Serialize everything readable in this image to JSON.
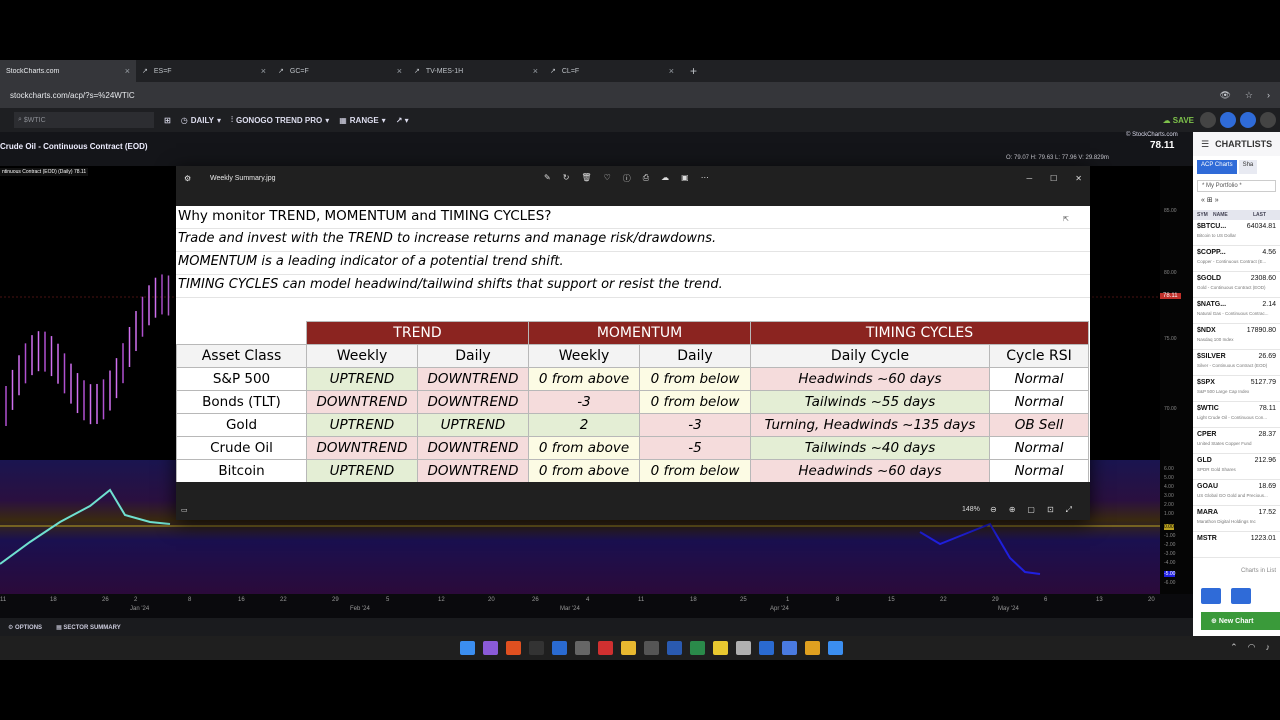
{
  "browser": {
    "tabs": [
      {
        "icon": "stockcharts-icon",
        "title": "StockCharts.com",
        "active": true
      },
      {
        "icon": "chart-icon",
        "title": "ES=F"
      },
      {
        "icon": "chart-icon",
        "title": "GC=F"
      },
      {
        "icon": "chart-icon",
        "title": "TV-MES-1H"
      },
      {
        "icon": "chart-icon",
        "title": "CL=F"
      }
    ],
    "new_tab": "+",
    "url": "stockcharts.com/acp/?s=%24WTIC"
  },
  "toolbar": {
    "symbol_placeholder": "$WTIC",
    "period": "DAILY",
    "indicator": "GONOGO TREND PRO",
    "range": "RANGE",
    "save": "SAVE"
  },
  "chart": {
    "title": "Crude Oil - Continuous Contract (EOD)",
    "sublabel": "ntinuous Contract (EOD) (Daily) 78.11",
    "last_price": "78.11",
    "logo": "© StockCharts.com",
    "ohlc": "O: 79.07   H: 79.63   L: 77.96   V: 29.829m",
    "price_marker": "78.11",
    "right_axis": [
      "85.00",
      "80.00",
      "75.00",
      "70.00",
      "6.00",
      "5.00",
      "4.00",
      "3.00",
      "2.00",
      "1.00",
      "0.00",
      "-1.00",
      "-2.00",
      "-3.00",
      "-4.00",
      "-5.00",
      "-6.00"
    ],
    "x_axis_dates": [
      "11",
      "18",
      "26",
      "2",
      "8",
      "16",
      "22",
      "29",
      "5",
      "12",
      "20",
      "26",
      "4",
      "11",
      "18",
      "25",
      "1",
      "8",
      "15",
      "22",
      "29",
      "6",
      "13",
      "20"
    ],
    "x_axis_months": [
      "Jan '24",
      "Feb '24",
      "Mar '24",
      "Apr '24",
      "May '24"
    ]
  },
  "statusbar": {
    "options": "OPTIONS",
    "sector": "SECTOR SUMMARY"
  },
  "sidebar": {
    "header": "CHARTLISTS",
    "tabs": [
      "ACP Charts",
      "Sha"
    ],
    "portfolio": "* My Portfolio *",
    "columns": [
      "SYM",
      "NAME",
      "LAST"
    ],
    "items": [
      {
        "sym": "$BTCU...",
        "desc": "Bitcoin to US Dollar",
        "last": "64034.81"
      },
      {
        "sym": "$COPP...",
        "desc": "Copper - Continuous Contract (E...",
        "last": "4.56"
      },
      {
        "sym": "$GOLD",
        "desc": "Gold - Continuous Contract (EOD)",
        "last": "2308.60"
      },
      {
        "sym": "$NATG...",
        "desc": "Natural Gas - Continuous Contrac...",
        "last": "2.14"
      },
      {
        "sym": "$NDX",
        "desc": "Nasdaq 100 Index",
        "last": "17890.80"
      },
      {
        "sym": "$SILVER",
        "desc": "Silver - Continuous Contract (EOD)",
        "last": "26.69"
      },
      {
        "sym": "$SPX",
        "desc": "S&P 500 Large Cap Index",
        "last": "5127.79"
      },
      {
        "sym": "$WTIC",
        "desc": "Light Crude Oil - Continuous Con...",
        "last": "78.11"
      },
      {
        "sym": "CPER",
        "desc": "United States Copper Fund",
        "last": "28.37"
      },
      {
        "sym": "GLD",
        "desc": "SPDR Gold Shares",
        "last": "212.96"
      },
      {
        "sym": "GOAU",
        "desc": "US Global GO Gold and Precious...",
        "last": "18.69"
      },
      {
        "sym": "MARA",
        "desc": "Marathon Digital Holdings Inc",
        "last": "17.52"
      },
      {
        "sym": "MSTR",
        "desc": "",
        "last": "1223.01"
      }
    ],
    "footer_label": "Charts in List",
    "new_chart": "New Chart"
  },
  "viewer": {
    "title": "Weekly Summary.jpg",
    "zoom": "148%",
    "image": {
      "lines": [
        "Why monitor TREND, MOMENTUM and TIMING CYCLES?",
        "Trade and invest with the TREND to increase returns and manage risk/drawdowns.",
        "MOMENTUM is a leading indicator of a potential trend shift.",
        "TIMING CYCLES can model headwind/tailwind shifts that support or resist the trend."
      ],
      "groups": [
        "TREND",
        "MOMENTUM",
        "TIMING CYCLES"
      ],
      "headers": [
        "Asset Class",
        "Weekly",
        "Daily",
        "Weekly",
        "Daily",
        "Daily Cycle",
        "Cycle RSI"
      ],
      "rows": [
        {
          "cells": [
            "S&P 500",
            "UPTREND",
            "DOWNTREND",
            "0 from above",
            "0 from below",
            "Headwinds ~60 days",
            "Normal"
          ],
          "colors": [
            "w",
            "g",
            "r",
            "y",
            "y",
            "r",
            "w"
          ]
        },
        {
          "cells": [
            "Bonds (TLT)",
            "DOWNTREND",
            "DOWNTREND",
            "-3",
            "0 from below",
            "Tailwinds ~55 days",
            "Normal"
          ],
          "colors": [
            "w",
            "r",
            "r",
            "r",
            "y",
            "g",
            "w"
          ]
        },
        {
          "cells": [
            "Gold",
            "UPTREND",
            "UPTREND",
            "2",
            "-3",
            "Turning, Headwinds ~135 days",
            "OB Sell"
          ],
          "colors": [
            "w",
            "g",
            "g",
            "g",
            "r",
            "r",
            "r"
          ]
        },
        {
          "cells": [
            "Crude Oil",
            "DOWNTREND",
            "DOWNTREND",
            "0 from above",
            "-5",
            "Tailwinds ~40 days",
            "Normal"
          ],
          "colors": [
            "w",
            "r",
            "r",
            "y",
            "r",
            "g",
            "w"
          ]
        },
        {
          "cells": [
            "Bitcoin",
            "UPTREND",
            "DOWNTREND",
            "0 from above",
            "0 from below",
            "Headwinds ~60 days",
            "Normal"
          ],
          "colors": [
            "w",
            "g",
            "r",
            "y",
            "y",
            "r",
            "w"
          ]
        }
      ]
    }
  },
  "colors": {
    "group_header": "#8b2420",
    "positive": "#e4eed5",
    "negative": "#f5dcdc",
    "neutral": "#fcfbe4",
    "accent": "#2f6bd8"
  }
}
